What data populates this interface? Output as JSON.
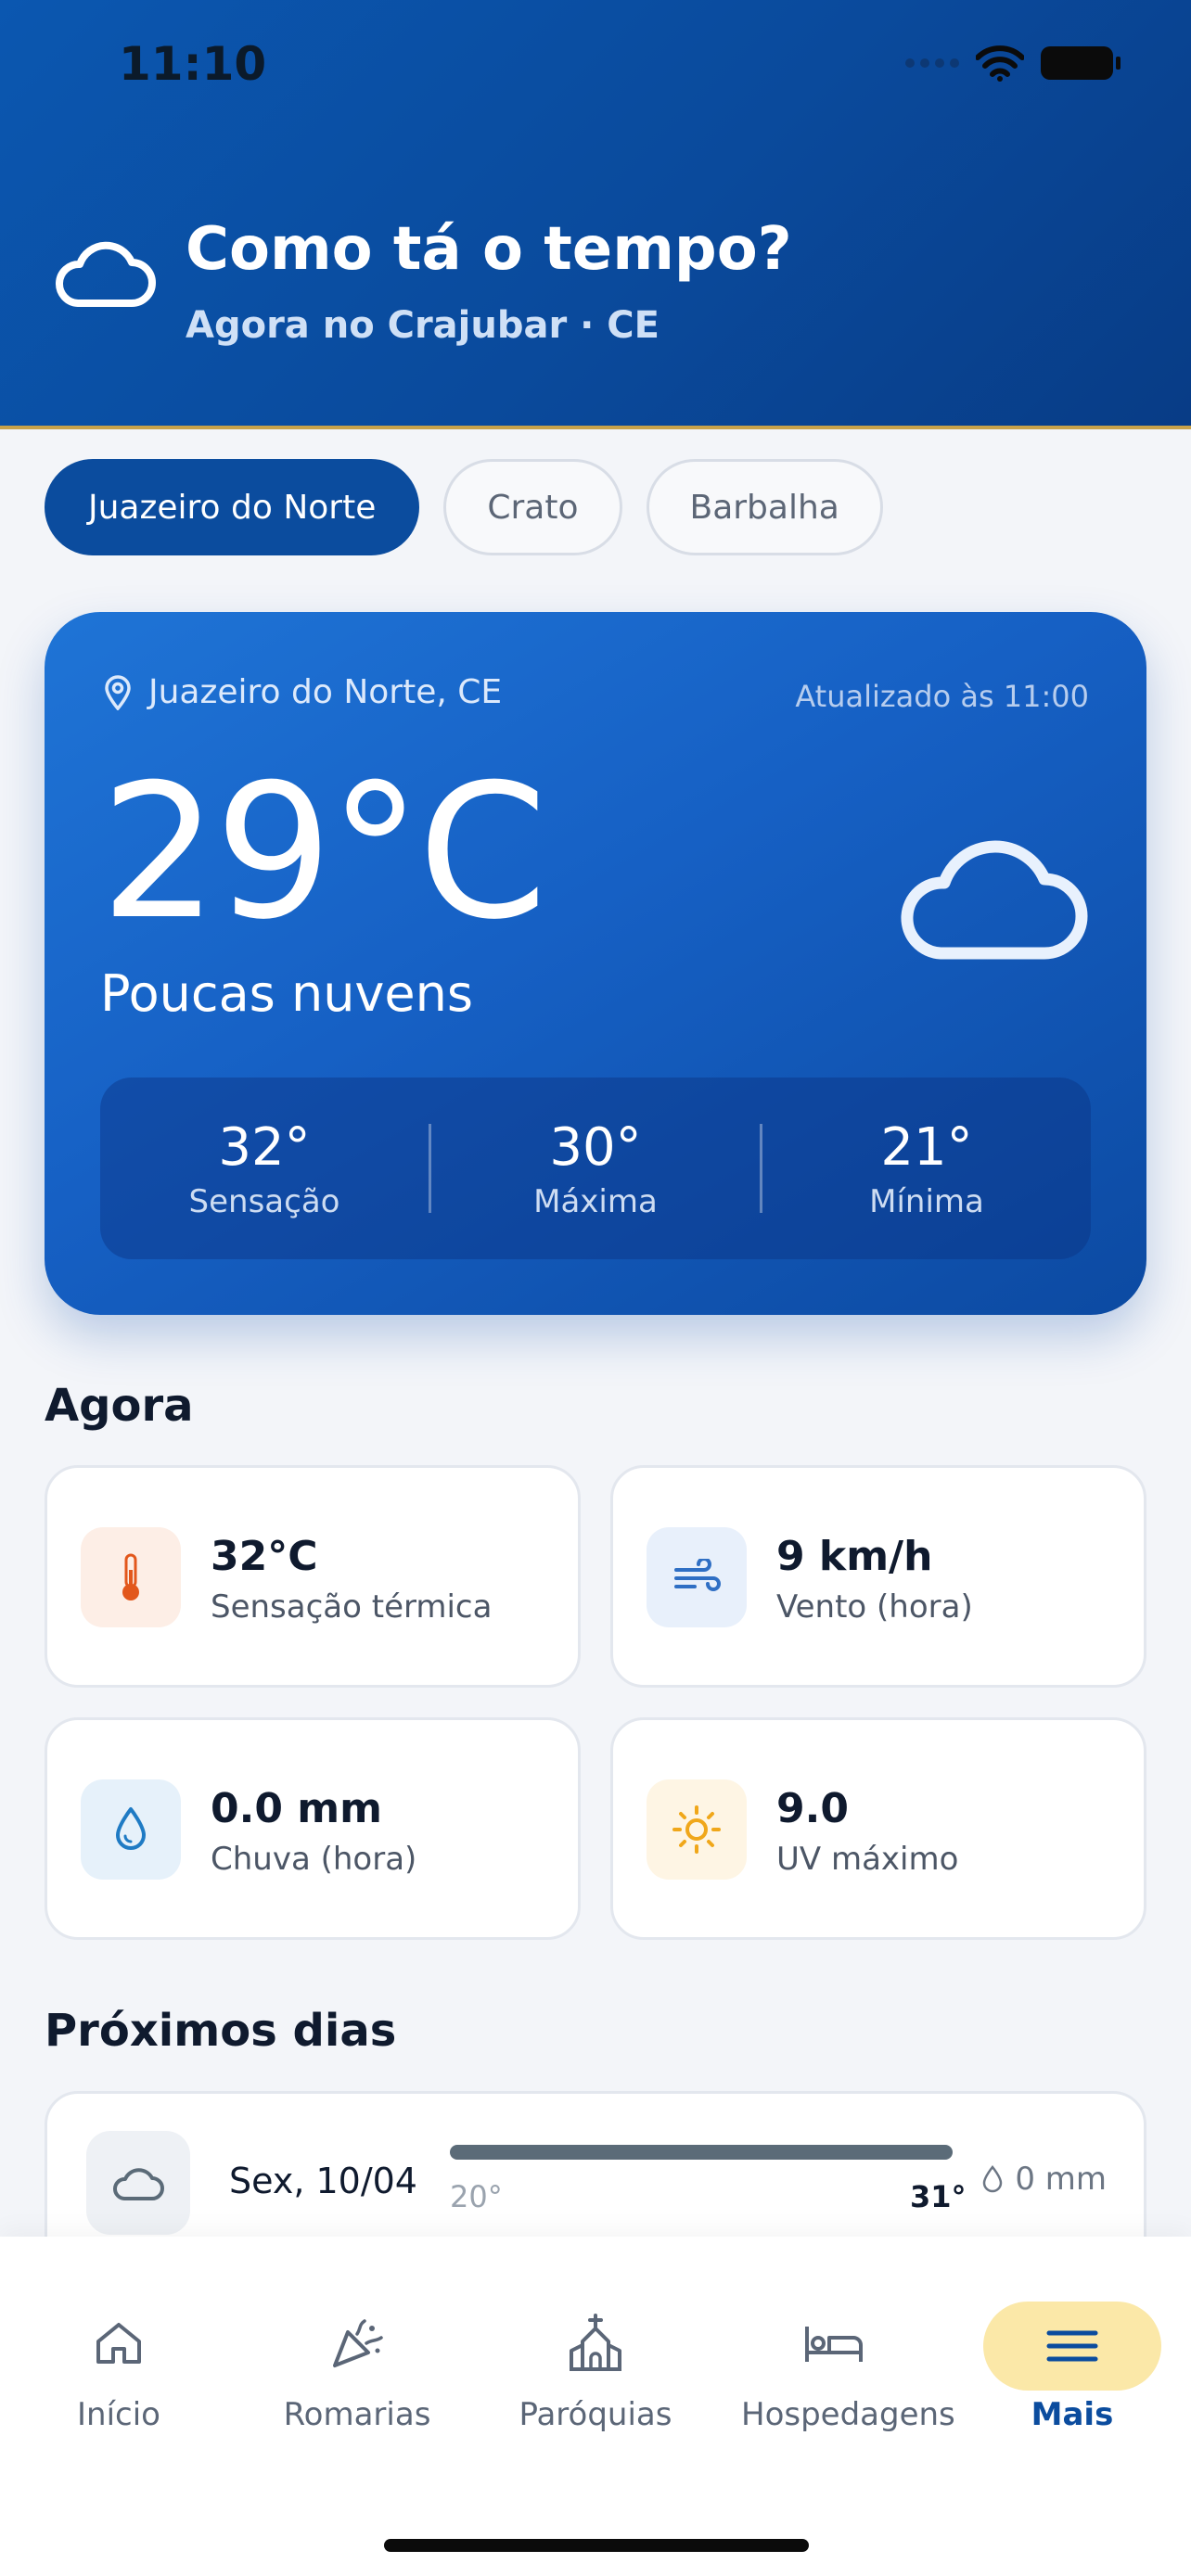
{
  "status": {
    "time": "11:10"
  },
  "header": {
    "title": "Como tá o tempo?",
    "subtitle": "Agora no Crajubar · CE"
  },
  "chips": [
    {
      "label": "Juazeiro do Norte",
      "active": true
    },
    {
      "label": "Crato",
      "active": false
    },
    {
      "label": "Barbalha",
      "active": false
    }
  ],
  "main_card": {
    "location": "Juazeiro do Norte, CE",
    "updated": "Atualizado às 11:00",
    "temperature": "29°C",
    "condition": "Poucas nuvens",
    "icon": "cloud-icon",
    "stats": [
      {
        "value": "32°",
        "label": "Sensação"
      },
      {
        "value": "30°",
        "label": "Máxima"
      },
      {
        "value": "21°",
        "label": "Mínima"
      }
    ]
  },
  "now": {
    "title": "Agora",
    "tiles": [
      {
        "value": "32°C",
        "label": "Sensação térmica",
        "icon": "thermometer-icon",
        "color": "#e2571c"
      },
      {
        "value": "9 km/h",
        "label": "Vento (hora)",
        "icon": "wind-icon",
        "color": "#2f6fc4"
      },
      {
        "value": "0.0 mm",
        "label": "Chuva (hora)",
        "icon": "droplet-icon",
        "color": "#1f7bc4"
      },
      {
        "value": "9.0",
        "label": "UV máximo",
        "icon": "sun-icon",
        "color": "#f0a71a"
      }
    ]
  },
  "forecast": {
    "title": "Próximos dias",
    "days": [
      {
        "day": "Sex, 10/04",
        "min": "20°",
        "max": "31°",
        "rain": "0 mm",
        "icon": "cloud-icon"
      }
    ]
  },
  "tabbar": {
    "items": [
      {
        "label": "Início",
        "icon": "home-icon"
      },
      {
        "label": "Romarias",
        "icon": "party-popper-icon"
      },
      {
        "label": "Paróquias",
        "icon": "church-icon"
      },
      {
        "label": "Hospedagens",
        "icon": "bed-icon"
      },
      {
        "label": "Mais",
        "icon": "menu-icon",
        "active": true
      }
    ]
  },
  "colors": {
    "primary": "#0b4c9e",
    "accent": "#fbe8a8",
    "card_gradient_start": "#1f74d6"
  }
}
